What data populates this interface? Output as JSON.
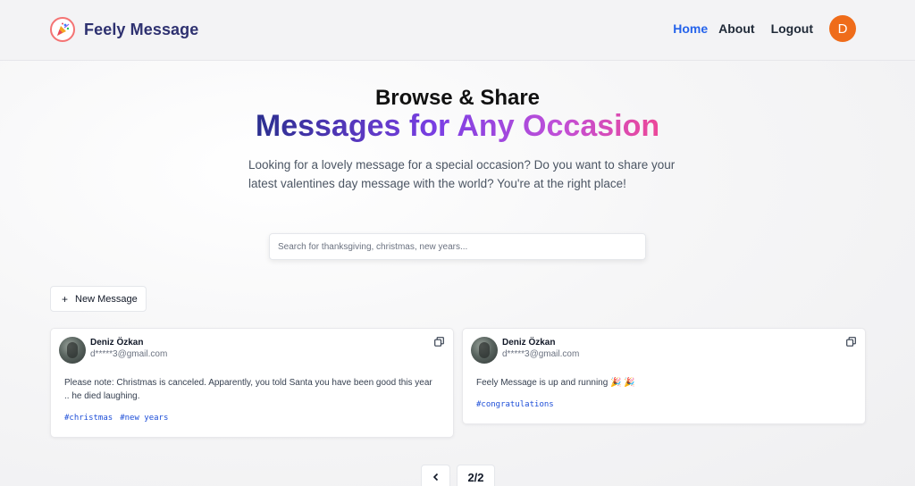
{
  "header": {
    "brand_name": "Feely Message",
    "nav": {
      "home": "Home",
      "about": "About",
      "logout": "Logout"
    },
    "avatar_initial": "D",
    "icons": {
      "logo": "party-popper-icon"
    }
  },
  "hero": {
    "line1": "Browse & Share",
    "line2": "Messages for Any Occasion",
    "description": "Looking for a lovely message for a special occasion? Do you want to share your latest valentines day message with the world? You're at the right place!"
  },
  "search": {
    "placeholder": "Search for thanksgiving, christmas, new years..."
  },
  "new_message": {
    "label": "New Message",
    "icon": "plus-icon"
  },
  "messages": [
    {
      "author": "Deniz Özkan",
      "email": "d*****3@gmail.com",
      "text": "Please note: Christmas is canceled. Apparently, you told Santa you have been good this year .. he died laughing.",
      "tags": [
        "#christmas",
        "#new years"
      ]
    },
    {
      "author": "Deniz Özkan",
      "email": "d*****3@gmail.com",
      "text": "Feely Message is up and running 🎉 🎉",
      "tags": [
        "#congratulations"
      ]
    }
  ],
  "pagination": {
    "label": "2/2",
    "prev_icon": "chevron-left-icon"
  },
  "colors": {
    "brand": "#2e3170",
    "accent": "#2563eb",
    "avatar": "#ef6c1a",
    "tag": "#1d4ed8"
  }
}
